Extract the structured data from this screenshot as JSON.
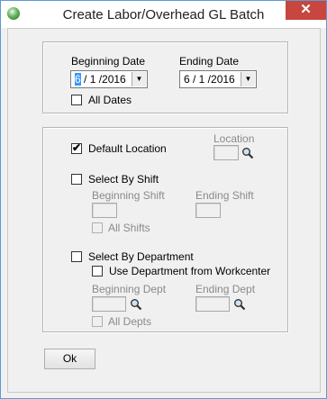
{
  "window": {
    "title": "Create Labor/Overhead GL Batch",
    "close_label": "✕"
  },
  "dates": {
    "beginning_label": "Beginning Date",
    "beginning_value_selected": "6",
    "beginning_value_rest": " / 1 /2016",
    "ending_label": "Ending Date",
    "ending_value": "6 / 1 /2016",
    "dropdown_arrow": "▼",
    "all_dates_label": "All Dates",
    "all_dates_checked": false
  },
  "location": {
    "default_location_label": "Default Location",
    "default_location_checked": true,
    "location_label": "Location",
    "location_value": ""
  },
  "shift": {
    "select_label": "Select By Shift",
    "select_checked": false,
    "beginning_label": "Beginning Shift",
    "ending_label": "Ending Shift",
    "all_label": "All Shifts"
  },
  "department": {
    "select_label": "Select By Department",
    "select_checked": false,
    "use_workcenter_label": "Use Department from Workcenter",
    "use_workcenter_checked": false,
    "beginning_label": "Beginning Dept",
    "ending_label": "Ending Dept",
    "all_label": "All Depts"
  },
  "buttons": {
    "ok_label": "Ok"
  },
  "checkmark": "✔",
  "icons": {
    "app": "app-icon",
    "lookup": "magnifier-icon"
  },
  "colors": {
    "close_button": "#c7463f",
    "selection": "#3399ff",
    "window_border": "#5a9bd1"
  }
}
